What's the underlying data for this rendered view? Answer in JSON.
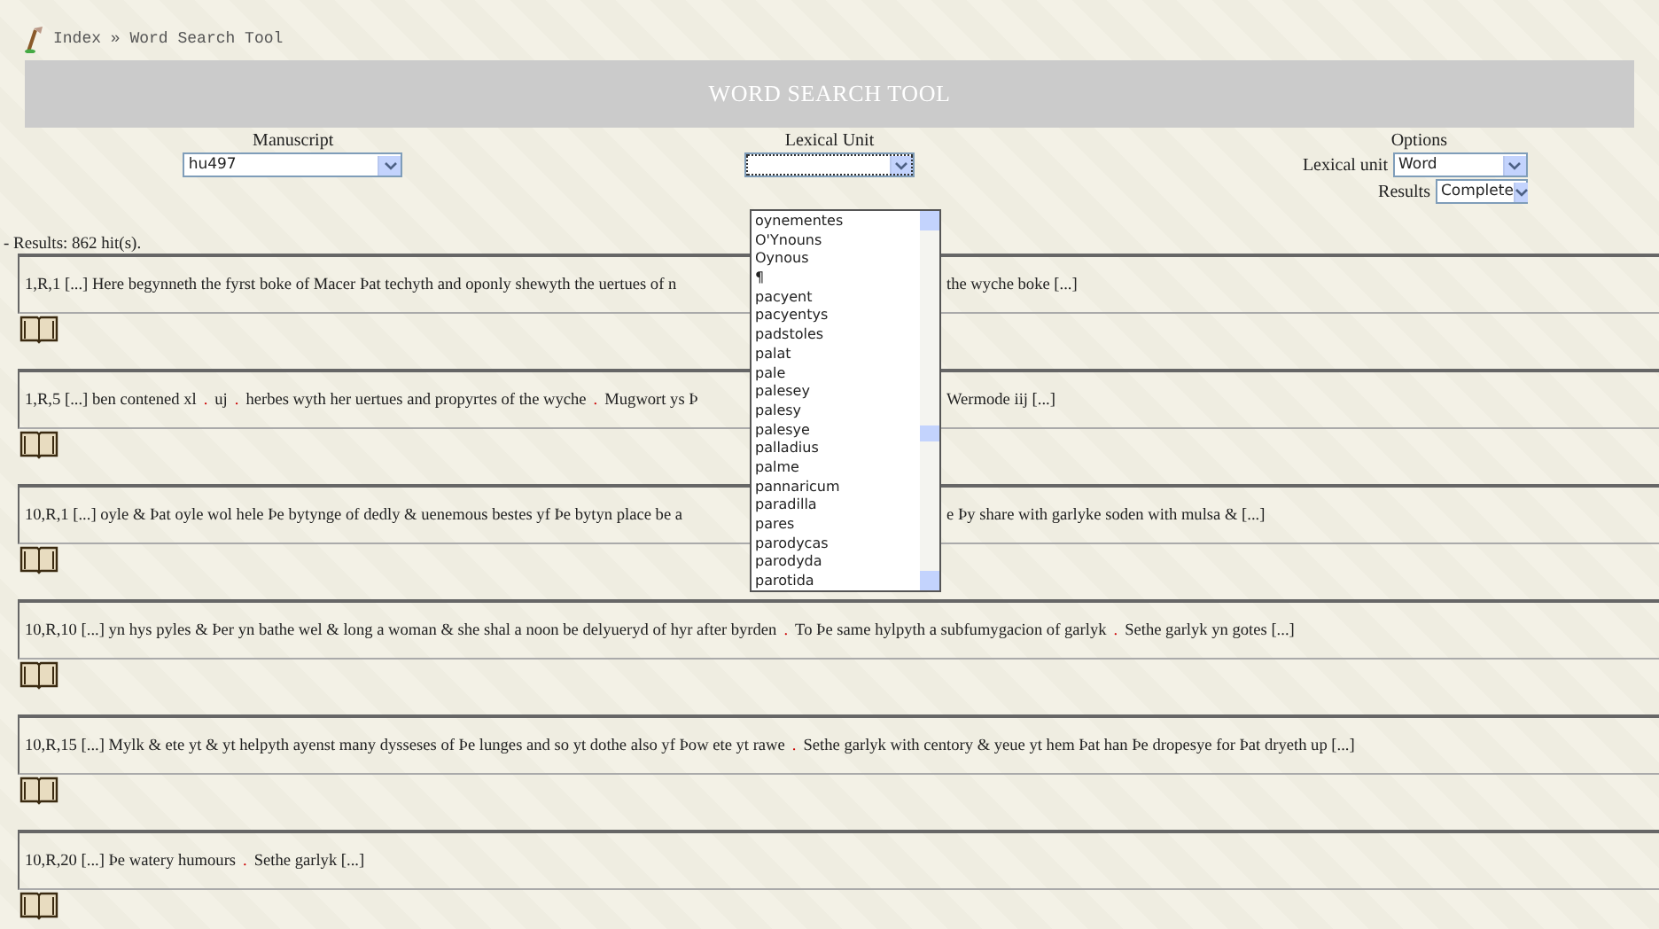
{
  "breadcrumb": {
    "home": "Index",
    "separator": "»",
    "current": "Word Search Tool"
  },
  "title": "WORD SEARCH TOOL",
  "manuscript": {
    "label": "Manuscript",
    "value": "hu497"
  },
  "lexical": {
    "label": "Lexical Unit",
    "focused": true,
    "open": true,
    "options": [
      "oynementes",
      "O'Ynouns",
      "Oynous",
      "¶",
      "pacyent",
      "pacyentys",
      "padstoles",
      "palat",
      "pale",
      "palesey",
      "palesy",
      "palesye",
      "palladius",
      "palme",
      "pannaricum",
      "paradilla",
      "pares",
      "parodycas",
      "parodyda",
      "parotida"
    ]
  },
  "options": {
    "label": "Options",
    "fields": [
      {
        "label": "Lexical unit",
        "value": "Word"
      },
      {
        "label": "Results",
        "value": "Complete"
      }
    ]
  },
  "summary": "- Results: 862 hit(s).",
  "results": [
    {
      "segments": [
        [
          {
            "kind": "text",
            "text": "1,R,1 [...] Here begynneth the fyrst boke of Macer Þat techyth and oponly shewyth the uertues of n"
          }
        ],
        [
          {
            "kind": "text",
            "text": "the wyche boke [...]"
          }
        ]
      ]
    },
    {
      "segments": [
        [
          {
            "kind": "text",
            "text": "1,R,5 [...] ben contened xl"
          },
          {
            "kind": "stop",
            "text": "."
          },
          {
            "kind": "text",
            "text": "uj"
          },
          {
            "kind": "stop",
            "text": "."
          },
          {
            "kind": "text",
            "text": "herbes wyth her uertues and propyrtes of the wyche"
          },
          {
            "kind": "stop",
            "text": "."
          },
          {
            "kind": "text",
            "text": "Mugwort ys Þ"
          }
        ],
        [
          {
            "kind": "text",
            "text": "Wermode iij [...]"
          }
        ]
      ]
    },
    {
      "segments": [
        [
          {
            "kind": "text",
            "text": "10,R,1 [...] oyle & Þat oyle wol hele Þe bytynge of dedly & uenemous bestes yf Þe bytyn place be a"
          }
        ],
        [
          {
            "kind": "text",
            "text": "e Þy share with garlyke soden with mulsa & [...]"
          }
        ]
      ]
    },
    {
      "segments": [
        [
          {
            "kind": "text",
            "text": "10,R,10 [...] yn hys pyles & Þer yn bathe wel & long a woman & she shal a noon be delyueryd of hyr after byrden"
          },
          {
            "kind": "stop",
            "text": "."
          },
          {
            "kind": "text",
            "text": "To Þe same hylpyth a subfumygacion of garlyk"
          },
          {
            "kind": "stop",
            "text": "."
          },
          {
            "kind": "text",
            "text": "Sethe garlyk yn gotes [...]"
          }
        ]
      ]
    },
    {
      "segments": [
        [
          {
            "kind": "text",
            "text": "10,R,15 [...] Mylk & ete yt & yt helpyth ayenst many dysseses of Þe lunges and so yt dothe also yf Þow ete yt rawe"
          },
          {
            "kind": "stop",
            "text": "."
          },
          {
            "kind": "text",
            "text": "Sethe garlyk with centory & yeue yt hem Þat han Þe dropesye for Þat dryeth up [...]"
          }
        ]
      ]
    },
    {
      "segments": [
        [
          {
            "kind": "text",
            "text": "10,R,20 [...] Þe watery humours"
          },
          {
            "kind": "stop",
            "text": "."
          },
          {
            "kind": "text",
            "text": "Sethe garlyk [...]"
          }
        ]
      ]
    }
  ]
}
